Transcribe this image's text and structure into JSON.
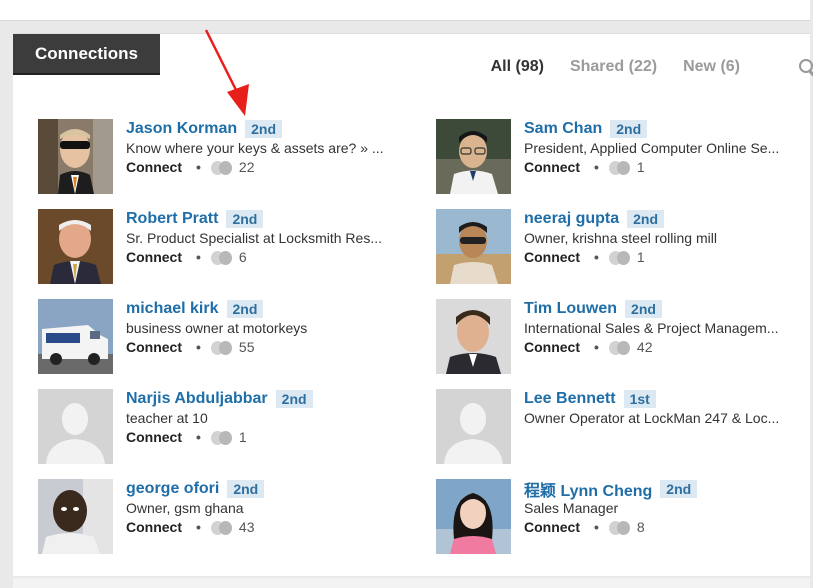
{
  "section": {
    "title": "Connections"
  },
  "filters": {
    "all": "All (98)",
    "shared": "Shared (22)",
    "new": "New (6)"
  },
  "colors": {
    "name_link": "#1f6ea8",
    "degree_badge_bg": "#dde9f2",
    "header_tab_bg": "#3c3c3c",
    "arrow": "#e8201c"
  },
  "connections": [
    {
      "name": "Jason Korman",
      "degree": "2nd",
      "headline": "Know where your keys & assets are? » ...",
      "action": "Connect",
      "shared": "22",
      "avatar": "photo"
    },
    {
      "name": "Sam Chan",
      "degree": "2nd",
      "headline": "President, Applied Computer Online Se...",
      "action": "Connect",
      "shared": "1",
      "avatar": "photo"
    },
    {
      "name": "Robert Pratt",
      "degree": "2nd",
      "headline": "Sr. Product Specialist at Locksmith Res...",
      "action": "Connect",
      "shared": "6",
      "avatar": "photo"
    },
    {
      "name": "neeraj gupta",
      "degree": "2nd",
      "headline": "Owner, krishna steel rolling mill",
      "action": "Connect",
      "shared": "1",
      "avatar": "photo"
    },
    {
      "name": "michael kirk",
      "degree": "2nd",
      "headline": "business owner at motorkeys",
      "action": "Connect",
      "shared": "55",
      "avatar": "photo"
    },
    {
      "name": "Tim Louwen",
      "degree": "2nd",
      "headline": "International Sales & Project Managem...",
      "action": "Connect",
      "shared": "42",
      "avatar": "photo"
    },
    {
      "name": "Narjis Abduljabbar",
      "degree": "2nd",
      "headline": "teacher at 10",
      "action": "Connect",
      "shared": "1",
      "avatar": "placeholder"
    },
    {
      "name": "Lee Bennett",
      "degree": "1st",
      "headline": "Owner Operator at LockMan 247 & Loc...",
      "action": "",
      "shared": "",
      "avatar": "placeholder"
    },
    {
      "name": "george ofori",
      "degree": "2nd",
      "headline": "Owner, gsm ghana",
      "action": "Connect",
      "shared": "43",
      "avatar": "photo"
    },
    {
      "name": "程颖 Lynn Cheng",
      "degree": "2nd",
      "headline": "Sales Manager",
      "action": "Connect",
      "shared": "8",
      "avatar": "photo"
    }
  ]
}
